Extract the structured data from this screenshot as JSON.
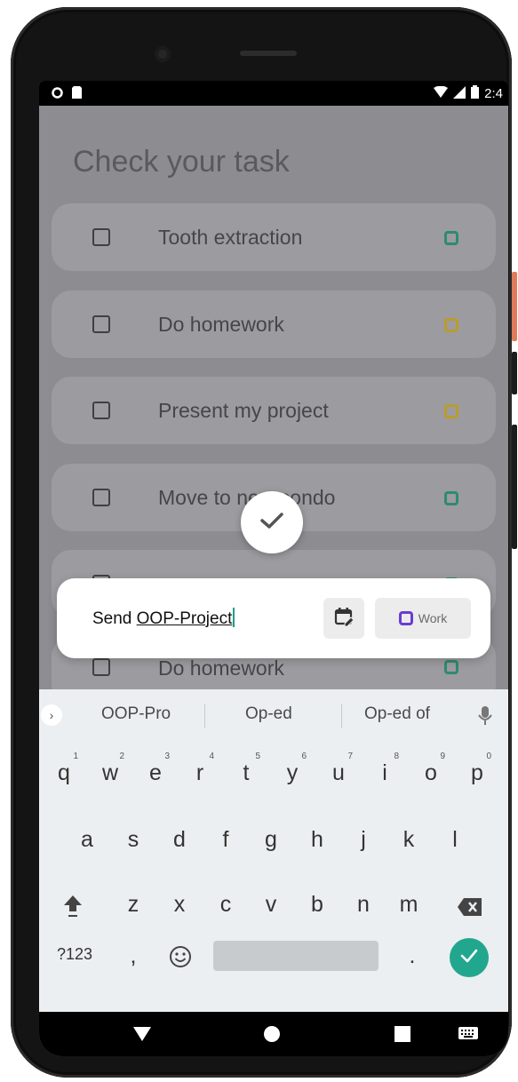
{
  "statusbar": {
    "time": "2:4"
  },
  "page": {
    "title": "Check your task"
  },
  "tasks": [
    {
      "label": "Tooth extraction",
      "tag_color": "#2f8a70"
    },
    {
      "label": "Do homework",
      "tag_color": "#b99c2e"
    },
    {
      "label": "Present my project",
      "tag_color": "#b99c2e"
    },
    {
      "label": "Move to new condo",
      "tag_color": "#2f8a70"
    },
    {
      "label": "",
      "tag_color": "#2f8a70"
    },
    {
      "label": "Do homework",
      "tag_color": "#2f8a70"
    }
  ],
  "input": {
    "prefix": "Send ",
    "typed": "OOP-Project",
    "category_label": "Work",
    "category_color": "#6c3bd3"
  },
  "keyboard": {
    "suggestions": [
      "OOP-Pro",
      "Op-ed",
      "Op-ed of"
    ],
    "row1": [
      "q",
      "w",
      "e",
      "r",
      "t",
      "y",
      "u",
      "i",
      "o",
      "p"
    ],
    "row1_hints": [
      "1",
      "2",
      "3",
      "4",
      "5",
      "6",
      "7",
      "8",
      "9",
      "0"
    ],
    "row2": [
      "a",
      "s",
      "d",
      "f",
      "g",
      "h",
      "j",
      "k",
      "l"
    ],
    "row3": [
      "z",
      "x",
      "c",
      "v",
      "b",
      "n",
      "m"
    ],
    "symbols_label": "?123",
    "comma": ",",
    "period": "."
  },
  "colors": {
    "accent": "#22a78f",
    "scrim": "#8d8c91"
  },
  "icons": [
    "check-icon",
    "calendar-edit-icon",
    "mic-icon",
    "shift-icon",
    "backspace-icon",
    "emoji-icon",
    "back-icon",
    "home-icon",
    "recents-icon",
    "keyboard-icon"
  ]
}
